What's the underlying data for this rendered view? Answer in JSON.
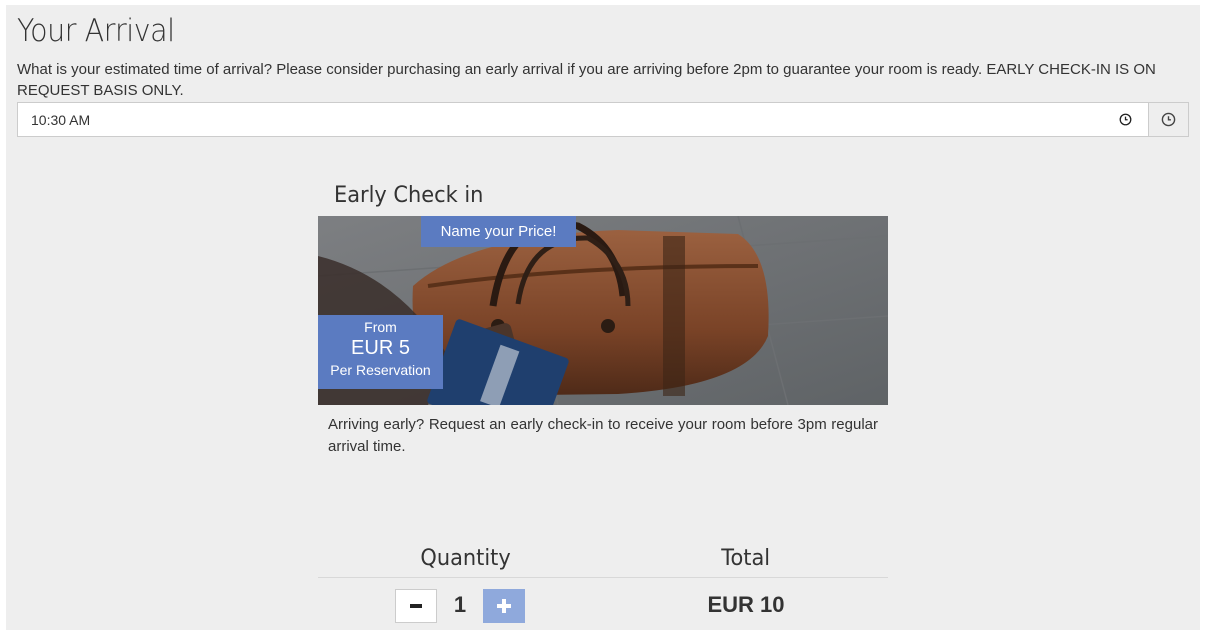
{
  "arrival": {
    "title": "Your Arrival",
    "description": "What is your estimated time of arrival? Please consider purchasing an early arrival if you are arriving before 2pm to guarantee your room is ready. EARLY CHECK-IN IS ON REQUEST BASIS ONLY.",
    "time_value": "10:30 AM",
    "time_icon": "clock-icon",
    "addon_icon": "clock-icon"
  },
  "card": {
    "title": "Early Check in",
    "badge": "Name your Price!",
    "from_label": "From",
    "price": "EUR 5",
    "per_label": "Per Reservation",
    "description": "Arriving early? Request an early check-in to receive your room before 3pm regular arrival time.",
    "image": "leather-bag-with-passport-photo",
    "accent_color": "#5b7bc1"
  },
  "order": {
    "quantity_header": "Quantity",
    "total_header": "Total",
    "minus_label": "−",
    "plus_label": "+",
    "quantity": "1",
    "total": "EUR 10"
  }
}
